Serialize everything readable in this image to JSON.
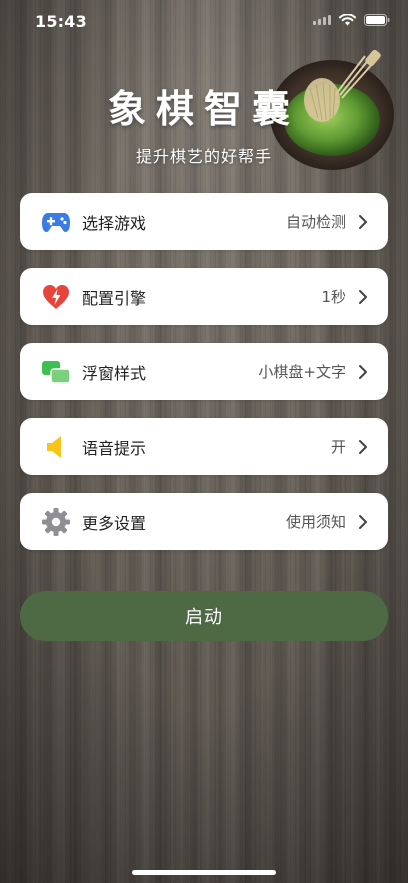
{
  "status_bar": {
    "time": "15:43"
  },
  "header": {
    "title": "象棋智囊",
    "subtitle": "提升棋艺的好帮手"
  },
  "menu": [
    {
      "id": "select-game",
      "icon": "gamepad-icon",
      "label": "选择游戏",
      "value": "自动检测"
    },
    {
      "id": "engine-config",
      "icon": "heart-bolt-icon",
      "label": "配置引擎",
      "value": "1秒"
    },
    {
      "id": "float-style",
      "icon": "windows-icon",
      "label": "浮窗样式",
      "value": "小棋盘+文字"
    },
    {
      "id": "voice-prompt",
      "icon": "speaker-icon",
      "label": "语音提示",
      "value": "开"
    },
    {
      "id": "more-settings",
      "icon": "gear-icon",
      "label": "更多设置",
      "value": "使用须知"
    }
  ],
  "start_button": {
    "label": "启动"
  },
  "colors": {
    "primary_button": "#4d6a45",
    "card_background": "#ffffff",
    "gamepad": "#3b7be6",
    "heart": "#e5453a",
    "windows": "#3fbf4f",
    "speaker": "#f5c518",
    "gear": "#8e8e93"
  }
}
